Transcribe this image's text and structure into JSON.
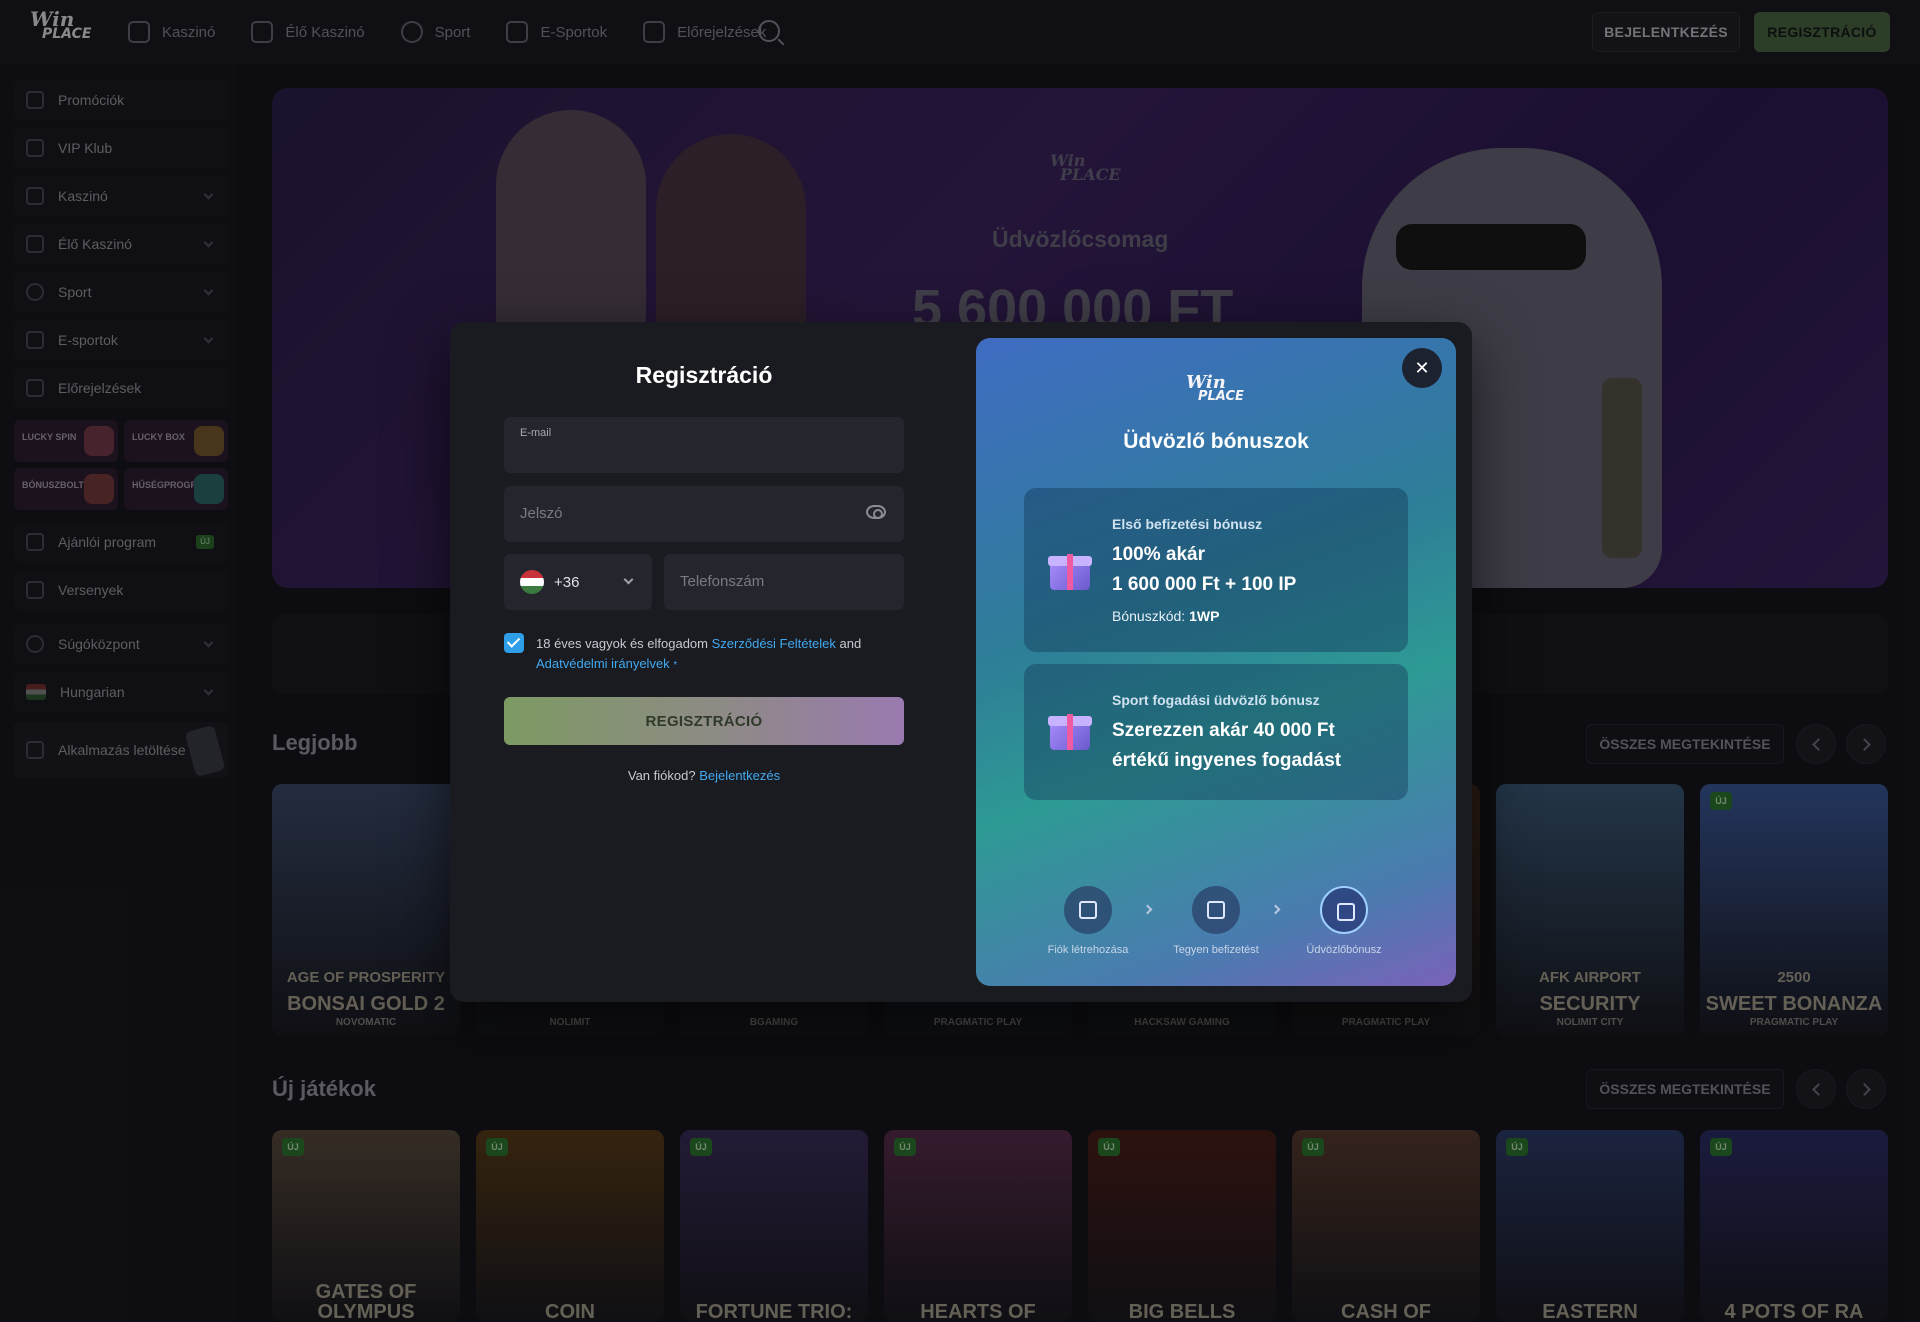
{
  "brand": {
    "logo_line1": "Win",
    "logo_line2": "PLACE"
  },
  "nav": {
    "items": [
      {
        "label": "Kaszinó",
        "icon": "slot-machine-icon"
      },
      {
        "label": "Élő Kaszinó",
        "icon": "dealer-icon"
      },
      {
        "label": "Sport",
        "icon": "soccer-ball-icon"
      },
      {
        "label": "E-Sportok",
        "icon": "gamepad-icon"
      },
      {
        "label": "Előrejelzések",
        "icon": "chart-icon"
      }
    ],
    "login_label": "BEJELENTKEZÉS",
    "register_label": "REGISZTRÁCIÓ"
  },
  "sidebar": {
    "items": [
      {
        "label": "Promóciók"
      },
      {
        "label": "VIP Klub"
      },
      {
        "label": "Kaszinó"
      },
      {
        "label": "Élő Kaszinó"
      },
      {
        "label": "Sport"
      },
      {
        "label": "E-sportok"
      },
      {
        "label": "Előrejelzések"
      }
    ],
    "tiles": [
      {
        "label": "LUCKY SPIN"
      },
      {
        "label": "LUCKY BOX"
      },
      {
        "label": "BÓNUSZBOLT"
      },
      {
        "label": "HŰSÉGPROGR..."
      }
    ],
    "referral": {
      "label": "Ajánlói program",
      "badge": "ÚJ"
    },
    "tournaments": "Versenyek",
    "help": "Súgóközpont",
    "language": "Hungarian",
    "app": "Alkalmazás letöltése"
  },
  "hero": {
    "logo_line1": "Win",
    "logo_line2": "PLACE",
    "title": "Üdvözlőcsomag",
    "amount": "5 600 000 FT"
  },
  "sections": {
    "best": {
      "title": "Legjobb",
      "see_all": "ÖSSZES MEGTEKINTÉSE"
    },
    "new": {
      "title": "Új játékok",
      "see_all": "ÖSSZES MEGTEKINTÉSE"
    }
  },
  "best_games": [
    {
      "title": "BONSAI GOLD 2",
      "subtitle_line": "AGE OF PROSPERITY",
      "provider": "NOVOMATIC",
      "color": "#3a4a6a"
    },
    {
      "title": "",
      "provider": "NOLIMIT",
      "color": "#1a2a3a"
    },
    {
      "title": "",
      "provider": "BGAMING",
      "color": "#4a1a22"
    },
    {
      "title": "",
      "provider": "PRAGMATIC PLAY",
      "color": "#1a3a5a"
    },
    {
      "title": "",
      "provider": "HACKSAW GAMING",
      "color": "#1a3a2e"
    },
    {
      "title": "",
      "provider": "PRAGMATIC PLAY",
      "color": "#4a2e1a"
    },
    {
      "title": "SECURITY",
      "subtitle_line": "AFK AIRPORT",
      "provider": "NOLIMIT CITY",
      "color": "#3a5a7a"
    },
    {
      "title": "SWEET BONANZA",
      "subtitle_line": "2500",
      "provider": "PRAGMATIC PLAY",
      "color": "#3a5aa0",
      "new": "ÚJ"
    }
  ],
  "new_games": [
    {
      "title": "GATES OF OLYMPUS",
      "color": "#5a4a3a",
      "new": "ÚJ"
    },
    {
      "title": "COIN",
      "color": "#5a3a12",
      "new": "ÚJ"
    },
    {
      "title": "FORTUNE TRIO:",
      "color": "#3a2a5a",
      "new": "ÚJ"
    },
    {
      "title": "HEARTS OF",
      "color": "#5a2a4a",
      "new": "ÚJ"
    },
    {
      "title": "BIG BELLS",
      "color": "#4a1a12",
      "new": "ÚJ"
    },
    {
      "title": "CASH OF",
      "color": "#5a3a2a",
      "new": "ÚJ"
    },
    {
      "title": "EASTERN",
      "color": "#2a3a6a",
      "new": "ÚJ"
    },
    {
      "title": "4 POTS OF RA",
      "color": "#2a2a6a",
      "new": "ÚJ"
    }
  ],
  "modal": {
    "title": "Regisztráció",
    "email_label": "E-mail",
    "email_value": "",
    "password_placeholder": "Jelszó",
    "country_code": "+36",
    "phone_placeholder": "Telefonszám",
    "terms": {
      "prefix": "18 éves vagyok és elfogadom",
      "link1": "Szerződési Feltételek",
      "and": "and",
      "link2": "Adatvédelmi irányelvek",
      "required": "*"
    },
    "submit_label": "REGISZTRÁCIÓ",
    "have_account": "Van fiókod?",
    "login_link": "Bejelentkezés",
    "bonus_panel": {
      "logo_line1": "Win",
      "logo_line2": "PLACE",
      "title": "Üdvözlő bónuszok",
      "cards": [
        {
          "kicker": "Első befizetési bónusz",
          "line1": "100% akár",
          "line2": "1 600 000 Ft + 100 IP",
          "code_label": "Bónuszkód:",
          "code": "1WP"
        },
        {
          "kicker": "Sport fogadási üdvözlő bónusz",
          "line1": "Szerezzen akár 40 000 Ft",
          "line2": "értékű ingyenes fogadást"
        }
      ],
      "steps": [
        {
          "label": "Fiók létrehozása",
          "icon": "login-icon"
        },
        {
          "label": "Tegyen befizetést",
          "icon": "wallet-icon"
        },
        {
          "label": "Üdvözlőbónusz",
          "icon": "gift-icon"
        }
      ],
      "close": "✕"
    }
  }
}
